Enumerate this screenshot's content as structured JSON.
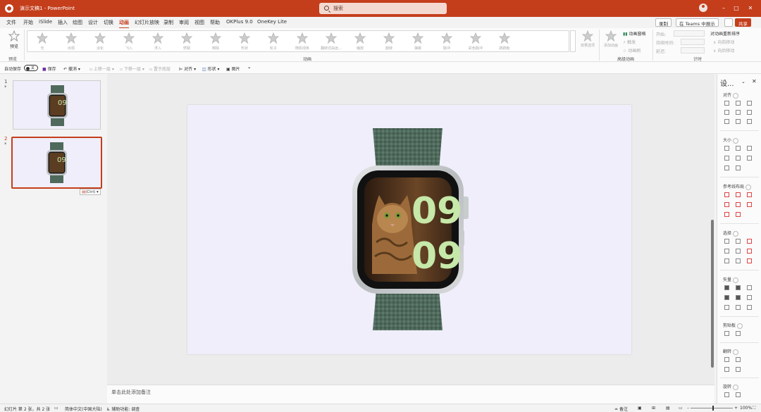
{
  "titlebar": {
    "doc_title": "演示文稿1 - PowerPoint",
    "search_placeholder": "搜索",
    "minimize": "–",
    "restore": "□",
    "close": "✕"
  },
  "menu": {
    "tabs": [
      "文件",
      "开始",
      "iSlide",
      "插入",
      "绘图",
      "设计",
      "切换",
      "动画",
      "幻灯片放映",
      "录制",
      "审阅",
      "视图",
      "帮助",
      "OKPlus 9.0",
      "OneKey Lite"
    ],
    "active_tab": "动画",
    "record_btn": "录制",
    "teams_btn": "在 Teams 中展示",
    "share_btn": "共享"
  },
  "ribbon": {
    "preview_label": "预览",
    "preview_group": "预览",
    "animations": [
      "无",
      "出现",
      "淡化",
      "飞入",
      "浮入",
      "劈裂",
      "擦除",
      "形状",
      "轮子",
      "随机线条",
      "翻转式由远...",
      "缩放",
      "旋转",
      "弹跳",
      "脉冲",
      "彩色脉冲",
      "跷跷板"
    ],
    "animations_group": "动画",
    "effect_options": "效果选项",
    "add_animation": "添加动画",
    "animation_pane": "动画窗格",
    "trigger": "触发",
    "animation_painter": "动画刷",
    "advanced_group": "高级动画",
    "start_label": "开始:",
    "duration_label": "持续时间:",
    "delay_label": "延迟:",
    "timing_group": "计时",
    "reorder_title": "对动画重新排序",
    "move_earlier": "向前移动",
    "move_later": "向后移动"
  },
  "quickbar": {
    "autosave": "自动保存",
    "autosave_state": "关",
    "save": "保存",
    "undo": "撤消",
    "prev_layer": "上移一层",
    "next_layer": "下移一层",
    "selection_pane": "置于底层",
    "align": "对齐",
    "shape": "形状",
    "picture": "图片"
  },
  "thumbs": {
    "slide1_num": "1",
    "slide2_num": "2",
    "star": "*",
    "paste_tag": "(Ctrl)"
  },
  "watch": {
    "face_digits_top": "09",
    "face_digits_bottom": "09"
  },
  "notes": {
    "placeholder": "单击此处添加备注"
  },
  "rpane": {
    "title": "设...",
    "sections": [
      "对齐",
      "大小",
      "参考线布局",
      "选择",
      "矢量",
      "剪贴板",
      "翻转",
      "旋转"
    ]
  },
  "status": {
    "slide_info": "幻灯片 第 2 张，共 2 张",
    "language": "简体中文(中国大陆)",
    "accessibility": "辅助功能: 调查",
    "notes_btn": "备注",
    "zoom": "100%"
  },
  "colors": {
    "accent": "#c43e1c",
    "slide_bg": "#f0eefb",
    "band": "#4f6a5c",
    "digit_green": "#c6e8a8"
  }
}
